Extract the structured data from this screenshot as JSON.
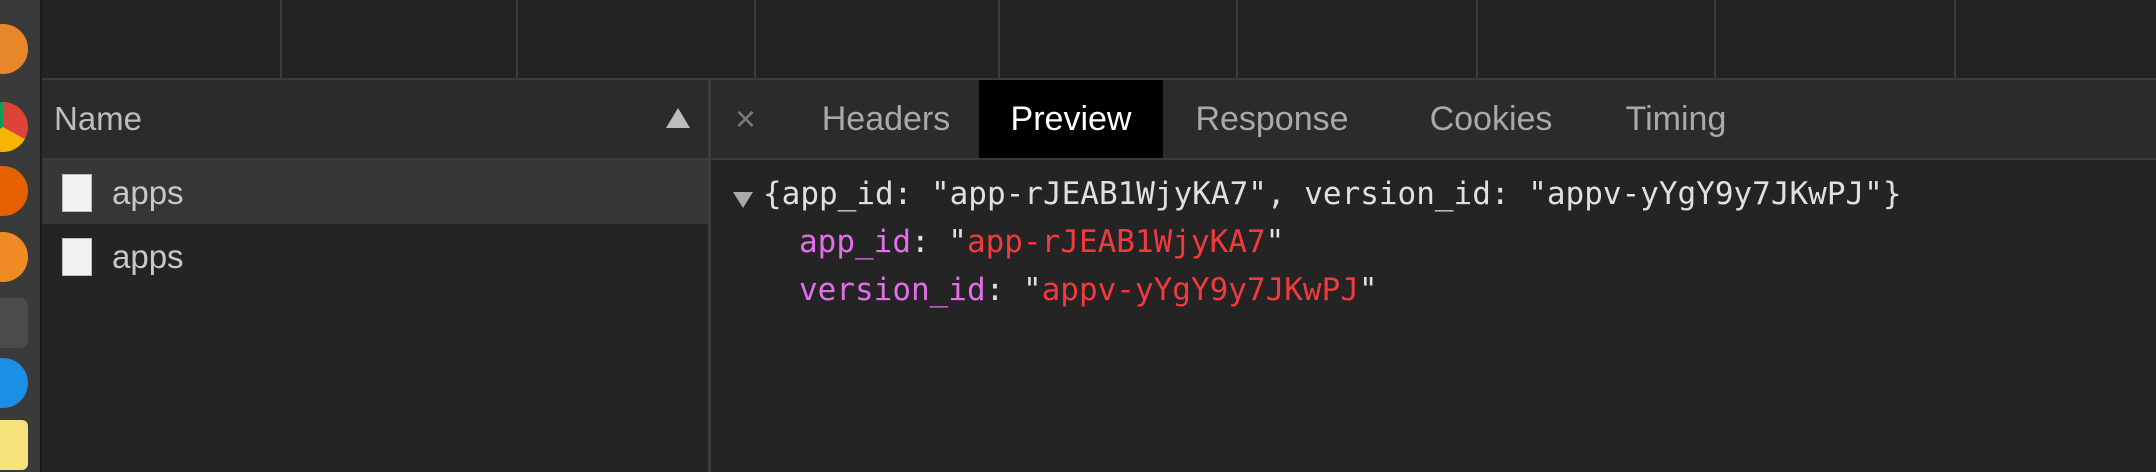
{
  "colors": {
    "background": "#242424",
    "header_background": "#2b2b2b",
    "active_tab_background": "#000000",
    "json_key": "#e36eec",
    "json_string": "#f2393d"
  },
  "network_list": {
    "name_header": "Name",
    "sort_icon": "triangle-up-icon",
    "requests": [
      {
        "label": "apps",
        "selected": true,
        "icon": "document-icon"
      },
      {
        "label": "apps",
        "selected": false,
        "icon": "document-icon"
      }
    ]
  },
  "detail": {
    "close_icon": "close-icon",
    "close_glyph": "×",
    "tabs": [
      {
        "label": "Headers",
        "active": false
      },
      {
        "label": "Preview",
        "active": true
      },
      {
        "label": "Response",
        "active": false
      },
      {
        "label": "Cookies",
        "active": false
      },
      {
        "label": "Timing",
        "active": false
      }
    ],
    "preview": {
      "summary": "{app_id: \"app-rJEAB1WjyKA7\", version_id: \"appv-yYgY9y7JKwPJ\"}",
      "properties": [
        {
          "key": "app_id",
          "value": "app-rJEAB1WjyKA7"
        },
        {
          "key": "version_id",
          "value": "appv-yYgY9y7JKwPJ"
        }
      ]
    }
  }
}
